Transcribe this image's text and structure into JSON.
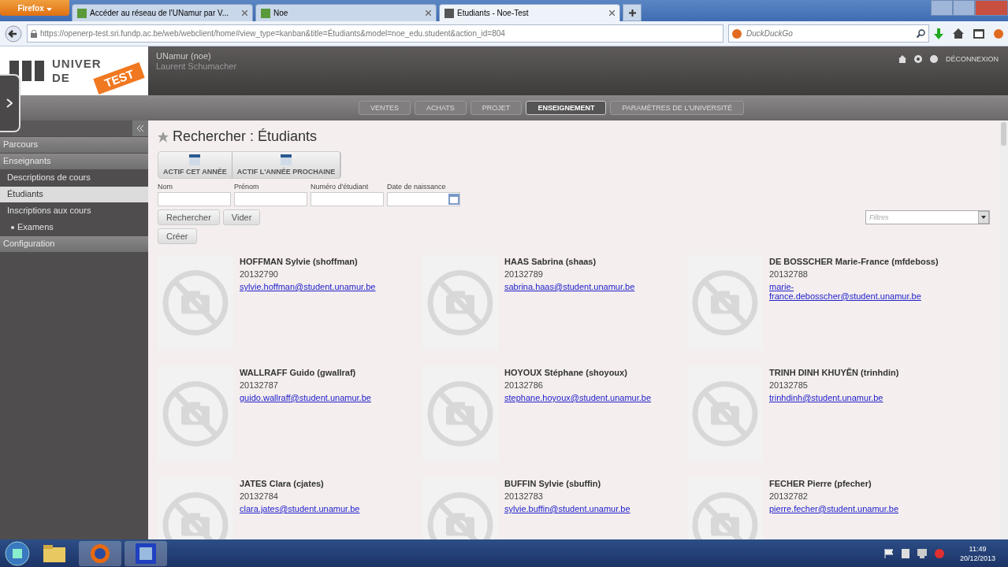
{
  "browser": {
    "menu_button": "Firefox",
    "tabs": [
      {
        "label": "Accéder au réseau de l'UNamur par V...",
        "selected": false
      },
      {
        "label": "Noe",
        "selected": false
      },
      {
        "label": "Étudiants - Noe-Test",
        "selected": true
      }
    ],
    "url": "https://openerp-test.sri.fundp.ac.be/web/webclient/home#view_type=kanban&title=Étudiants&model=noe_edu.student&action_id=804",
    "search": {
      "placeholder": "DuckDuckGo"
    }
  },
  "header": {
    "logo_lines": [
      "UNIVER",
      "DE"
    ],
    "badge": "TEST",
    "company": "UNamur (noe)",
    "user": "Laurent Schumacher",
    "logout": "DÉCONNEXION"
  },
  "menu": [
    {
      "label": "VENTES",
      "selected": false
    },
    {
      "label": "ACHATS",
      "selected": false
    },
    {
      "label": "PROJET",
      "selected": false
    },
    {
      "label": "ENSEIGNEMENT",
      "selected": true
    },
    {
      "label": "PARAMÈTRES DE L'UNIVERSITÉ",
      "selected": false
    }
  ],
  "sidebar": {
    "items": [
      {
        "label": "Parcours",
        "kind": "section"
      },
      {
        "label": "Enseignants",
        "kind": "section"
      },
      {
        "label": "Descriptions de cours",
        "kind": "item",
        "selected": false
      },
      {
        "label": "Étudiants",
        "kind": "item",
        "selected": true
      },
      {
        "label": "Inscriptions aux cours",
        "kind": "item",
        "selected": false,
        "children": [
          {
            "label": "Examens",
            "kind": "subitem",
            "selected": false
          }
        ]
      },
      {
        "label": "Configuration",
        "kind": "section"
      }
    ]
  },
  "page": {
    "title": "Rechercher : Étudiants",
    "filter_buttons": [
      "ACTIF CET ANNÉE",
      "ACTIF L'ANNÉE PROCHAINE"
    ],
    "fields": [
      {
        "label": "Nom",
        "kind": "text"
      },
      {
        "label": "Prénom",
        "kind": "text"
      },
      {
        "label": "Numéro d'étudiant",
        "kind": "text"
      },
      {
        "label": "Date de naissance",
        "kind": "date"
      }
    ],
    "search_button": "Rechercher",
    "clear_button": "Vider",
    "filters": {
      "placeholder": "Filtres"
    },
    "create_button": "Créer",
    "students": [
      {
        "name": "HOFFMAN Sylvie (shoffman)",
        "number": "20132790",
        "email": "sylvie.hoffman@student.unamur.be"
      },
      {
        "name": "HAAS Sabrina (shaas)",
        "number": "20132789",
        "email": "sabrina.haas@student.unamur.be"
      },
      {
        "name": "DE BOSSCHER Marie-France (mfdeboss)",
        "number": "20132788",
        "email": "marie-france.debosscher@student.unamur.be"
      },
      {
        "name": "WALLRAFF Guido (gwallraf)",
        "number": "20132787",
        "email": "guido.wallraff@student.unamur.be"
      },
      {
        "name": "HOYOUX Stéphane (shoyoux)",
        "number": "20132786",
        "email": "stephane.hoyoux@student.unamur.be"
      },
      {
        "name": "TRINH DINH KHUYÊN (trinhdin)",
        "number": "20132785",
        "email": "trinhdinh@student.unamur.be"
      },
      {
        "name": "JATES Clara (cjates)",
        "number": "20132784",
        "email": "clara.jates@student.unamur.be"
      },
      {
        "name": "BUFFIN Sylvie (sbuffin)",
        "number": "20132783",
        "email": "sylvie.buffin@student.unamur.be"
      },
      {
        "name": "FECHER Pierre (pfecher)",
        "number": "20132782",
        "email": "pierre.fecher@student.unamur.be"
      }
    ]
  },
  "taskbar": {
    "time": "11:49",
    "date": "20/12/2013"
  }
}
